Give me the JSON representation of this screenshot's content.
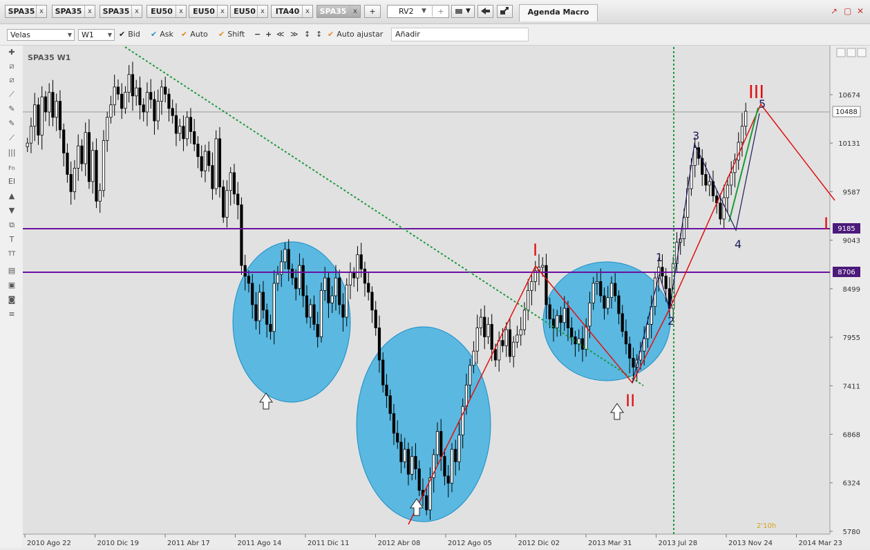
{
  "tabs": [
    {
      "label": "SPA35",
      "close": "x"
    },
    {
      "label": "SPA35",
      "close": "x"
    },
    {
      "label": "SPA35",
      "close": "x"
    },
    {
      "label": "EU50",
      "close": "x"
    },
    {
      "label": "EU50",
      "close": "x"
    },
    {
      "label": "EU50",
      "close": "x"
    },
    {
      "label": "ITA40",
      "close": "x"
    },
    {
      "label": "SPA35",
      "close": "x"
    }
  ],
  "add_tab_label": "+",
  "rv": {
    "label": "RV2",
    "chevron": "▼",
    "plus": "+"
  },
  "agenda_label": "Agenda Macro",
  "window_buttons": {
    "undock": "↗",
    "maximize": "▢",
    "close": "✕"
  },
  "toolbar": {
    "chart_type": "Velas",
    "timeframe": "W1",
    "bid": "Bid",
    "ask": "Ask",
    "auto": "Auto",
    "shift": "Shift",
    "minus": "−",
    "plus": "+",
    "rewind": "≪",
    "forward": "≫",
    "auto_fit": "Auto ajustar",
    "add": "Añadir"
  },
  "side_tools": [
    "✚",
    "⧄",
    "⧄",
    "⟋",
    "✎",
    "✎",
    "⟋",
    "|||",
    "Fn",
    "EI",
    "▲",
    "▼",
    "⧉",
    "T",
    "TT",
    "▤",
    "▣",
    "◙",
    "≡"
  ],
  "colors": {
    "bg": "#e1e1e1",
    "bull": "#ffffff",
    "bear": "#000000",
    "level": "#6a0fa0",
    "trend": "#1a9a3a",
    "wave_red": "#e01010",
    "wave_navy": "#1a1a5a",
    "ellipse": "#3aaee0"
  },
  "chart_data": {
    "type": "candlestick",
    "title": "SPA35 W1",
    "y_ticks": [
      5780,
      6324,
      6868,
      7411,
      7955,
      8499,
      9043,
      9587,
      10131,
      10674
    ],
    "x_ticks": [
      "2010 Ago 22",
      "2010 Dic 19",
      "2011 Abr 17",
      "2011 Ago 14",
      "2011 Dic 11",
      "2012 Abr 08",
      "2012 Ago 05",
      "2012 Dic 02",
      "2013 Mar 31",
      "2013 Jul 28",
      "2013 Nov 24",
      "2014 Mar 23"
    ],
    "x_range": [
      "2010 Jul 25",
      "2014 May 04"
    ],
    "y_range": [
      5700,
      11000
    ],
    "current_price": 10488,
    "levels": [
      9185,
      8706
    ],
    "candles": [
      10131,
      10320,
      10560,
      10220,
      10650,
      10480,
      10700,
      10420,
      10600,
      10280,
      10020,
      9780,
      9587,
      9850,
      10100,
      9900,
      10250,
      9700,
      10050,
      9480,
      9600,
      10160,
      10420,
      10560,
      10760,
      10680,
      10520,
      10700,
      10900,
      10660,
      10750,
      10560,
      10480,
      10700,
      10620,
      10380,
      10600,
      10760,
      10680,
      10520,
      10440,
      10240,
      10320,
      10180,
      10420,
      10260,
      10120,
      9980,
      9820,
      10040,
      9880,
      9620,
      10180,
      9640,
      9300,
      9600,
      9800,
      9560,
      9440,
      8760,
      8640,
      8560,
      8320,
      8140,
      8460,
      8260,
      8100,
      8020,
      8560,
      8660,
      8800,
      8940,
      8720,
      8620,
      8500,
      8760,
      8420,
      8180,
      8320,
      8100,
      7960,
      8480,
      8620,
      8340,
      8420,
      8620,
      8320,
      8180,
      8540,
      8680,
      8620,
      8880,
      8720,
      8560,
      8460,
      8260,
      8060,
      7700,
      7420,
      7300,
      7100,
      6880,
      6780,
      6560,
      6700,
      6420,
      6620,
      6480,
      6240,
      6180,
      6020,
      6380,
      6640,
      6900,
      6620,
      6400,
      6320,
      6700,
      6560,
      6860,
      7180,
      7420,
      7640,
      7800,
      8060,
      8180,
      7960,
      8100,
      7820,
      7700,
      7920,
      7860,
      8040,
      7740,
      7900,
      7980,
      8040,
      8260,
      8480,
      8580,
      8700,
      8740,
      8760,
      8320,
      8160,
      8060,
      8200,
      8120,
      8280,
      8060,
      7960,
      7880,
      7940,
      7820,
      8080,
      8340,
      8560,
      8580,
      8420,
      8280,
      8400,
      8560,
      8420,
      8220,
      8020,
      7880,
      7720,
      7620,
      7700,
      7800,
      7940,
      8100,
      8300,
      8620,
      8740,
      8640,
      8500,
      8280,
      8780,
      9020,
      9060,
      9300,
      9620,
      9880,
      10080,
      9960,
      9780,
      9660,
      9700,
      9540,
      9460,
      9280,
      9520,
      9660,
      9800,
      9940,
      10140,
      10320,
      10488
    ]
  },
  "annotations": {
    "wave_1": "1",
    "wave_2": "2",
    "wave_3": "3",
    "wave_4": "4",
    "wave_5": "5",
    "roman_I": "I",
    "roman_II": "II",
    "roman_III": "III",
    "roman_I_right": "I",
    "label_9185": "9185",
    "label_8706": "8706",
    "label_price": "10488",
    "timer": "2'10h"
  }
}
